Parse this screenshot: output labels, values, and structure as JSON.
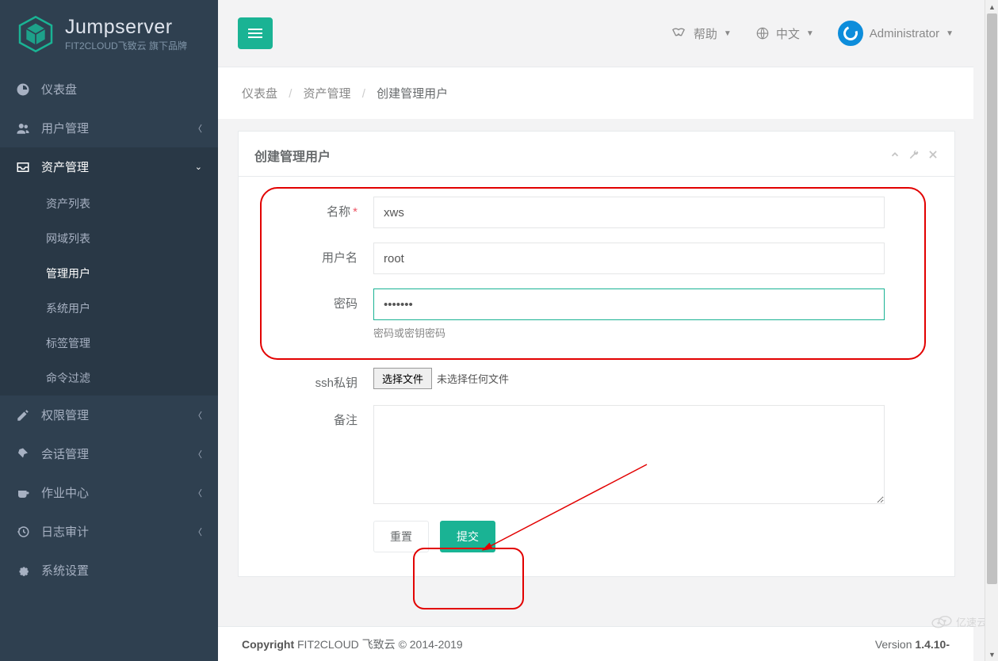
{
  "brand": {
    "name": "Jumpserver",
    "tagline": "FIT2CLOUD飞致云 旗下品牌"
  },
  "topnav": {
    "help": "帮助",
    "language": "中文",
    "user": "Administrator"
  },
  "sidebar": {
    "items": [
      {
        "label": "仪表盘"
      },
      {
        "label": "用户管理"
      },
      {
        "label": "资产管理"
      },
      {
        "label": "权限管理"
      },
      {
        "label": "会话管理"
      },
      {
        "label": "作业中心"
      },
      {
        "label": "日志审计"
      },
      {
        "label": "系统设置"
      }
    ],
    "asset_submenu": [
      {
        "label": "资产列表"
      },
      {
        "label": "网域列表"
      },
      {
        "label": "管理用户"
      },
      {
        "label": "系统用户"
      },
      {
        "label": "标签管理"
      },
      {
        "label": "命令过滤"
      }
    ]
  },
  "breadcrumb": {
    "a": "仪表盘",
    "b": "资产管理",
    "c": "创建管理用户"
  },
  "panel": {
    "title": "创建管理用户"
  },
  "form": {
    "name_label": "名称",
    "name_value": "xws",
    "username_label": "用户名",
    "username_value": "root",
    "password_label": "密码",
    "password_value": "•••••••",
    "password_help": "密码或密钥密码",
    "sshkey_label": "ssh私钥",
    "file_button": "选择文件",
    "file_text": "未选择任何文件",
    "comment_label": "备注",
    "reset_btn": "重置",
    "submit_btn": "提交"
  },
  "footer": {
    "copyright_bold": "Copyright",
    "copyright_rest": " FIT2CLOUD 飞致云 © 2014-2019",
    "version_pre": "Version ",
    "version_bold": "1.4.10-"
  },
  "watermark": "亿速云"
}
